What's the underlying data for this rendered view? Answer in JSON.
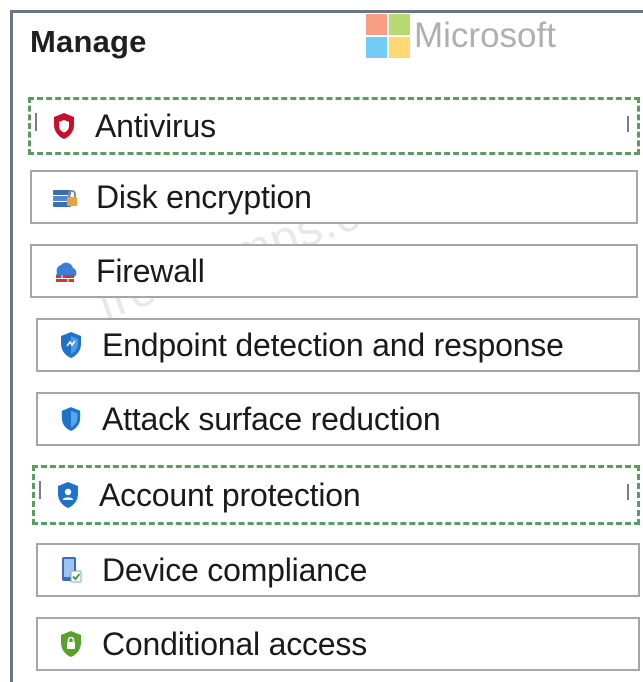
{
  "panel": {
    "title": "Manage"
  },
  "brand": {
    "name": "Microsoft",
    "logo_colors": [
      "#f25022",
      "#7fba00",
      "#00a4ef",
      "#ffb900"
    ]
  },
  "watermark": {
    "text": "freedumps.com"
  },
  "menu": {
    "items": [
      {
        "label": "Antivirus",
        "icon": "antivirus-shield-icon",
        "selected": true
      },
      {
        "label": "Disk encryption",
        "icon": "disk-encryption-icon",
        "selected": false
      },
      {
        "label": "Firewall",
        "icon": "firewall-icon",
        "selected": false
      },
      {
        "label": "Endpoint detection and response",
        "icon": "endpoint-shield-icon",
        "selected": false
      },
      {
        "label": "Attack surface reduction",
        "icon": "attack-surface-shield-icon",
        "selected": false
      },
      {
        "label": "Account protection",
        "icon": "account-protection-icon",
        "selected": true
      },
      {
        "label": "Device compliance",
        "icon": "device-compliance-icon",
        "selected": false
      },
      {
        "label": "Conditional access",
        "icon": "conditional-access-icon",
        "selected": false
      }
    ]
  },
  "colors": {
    "selection_border": "#5e9b5e",
    "item_border": "#a6a6a6",
    "antivirus_icon": "#c8102e",
    "shield_blue": "#1e73c8",
    "conditional_green": "#5aa02c"
  }
}
